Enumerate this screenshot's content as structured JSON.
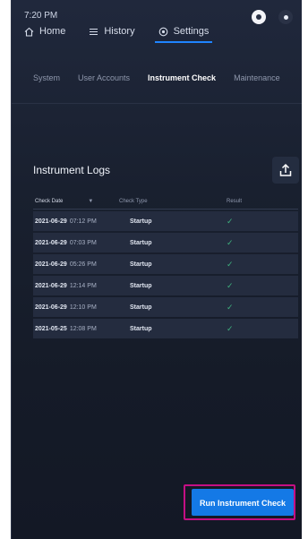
{
  "status": {
    "time": "7:20 PM"
  },
  "topnav": [
    {
      "label": "Home",
      "icon": "home-icon",
      "active": false
    },
    {
      "label": "History",
      "icon": "list-icon",
      "active": false
    },
    {
      "label": "Settings",
      "icon": "gear-icon",
      "active": true
    }
  ],
  "subtabs": [
    {
      "label": "System",
      "active": false
    },
    {
      "label": "User Accounts",
      "active": false
    },
    {
      "label": "Instrument Check",
      "active": true
    },
    {
      "label": "Maintenance",
      "active": false
    }
  ],
  "logs": {
    "title": "Instrument Logs",
    "columns": [
      "Check Date",
      "Check Type",
      "Result"
    ],
    "rows": [
      {
        "date": "2021-06-29",
        "time": "07:12 PM",
        "type": "Startup",
        "result": "✓"
      },
      {
        "date": "2021-06-29",
        "time": "07:03 PM",
        "type": "Startup",
        "result": "✓"
      },
      {
        "date": "2021-06-29",
        "time": "05:26 PM",
        "type": "Startup",
        "result": "✓"
      },
      {
        "date": "2021-06-29",
        "time": "12:14 PM",
        "type": "Startup",
        "result": "✓"
      },
      {
        "date": "2021-06-29",
        "time": "12:10 PM",
        "type": "Startup",
        "result": "✓"
      },
      {
        "date": "2021-05-25",
        "time": "12:08 PM",
        "type": "Startup",
        "result": "✓"
      }
    ]
  },
  "actions": {
    "run_label": "Run Instrument Check"
  },
  "colors": {
    "accent": "#1479e6",
    "highlight": "#c40f84",
    "success": "#3fb27f"
  }
}
